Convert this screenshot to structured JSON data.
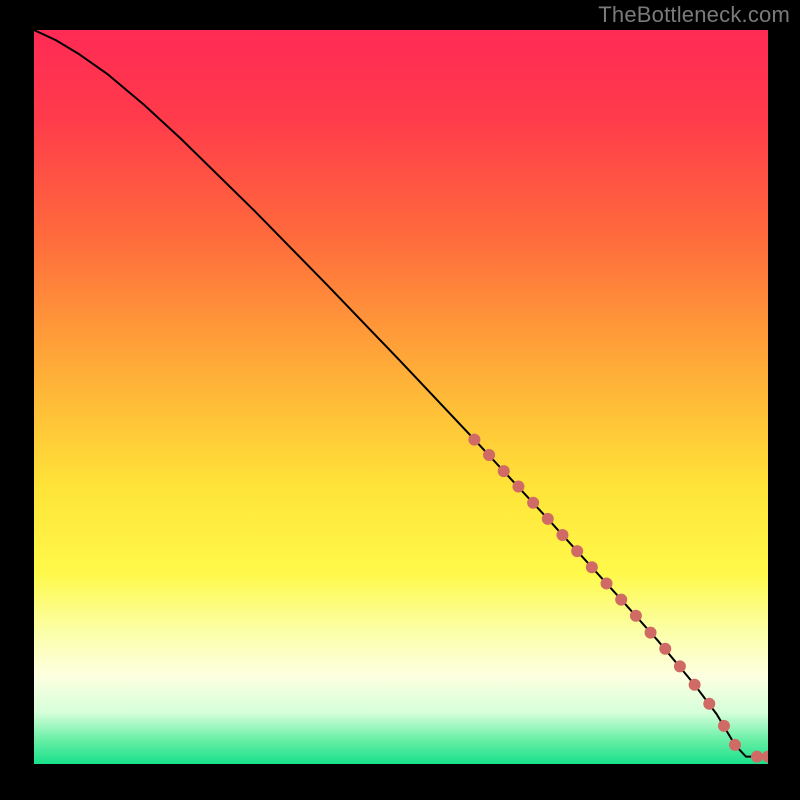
{
  "watermark": "TheBottleneck.com",
  "colors": {
    "frame": "#000000",
    "watermark": "#7a7a7a",
    "gradient_stops": [
      {
        "offset": 0.0,
        "color": "#ff2a55"
      },
      {
        "offset": 0.12,
        "color": "#ff3b4b"
      },
      {
        "offset": 0.28,
        "color": "#ff6a3c"
      },
      {
        "offset": 0.45,
        "color": "#ffa838"
      },
      {
        "offset": 0.62,
        "color": "#ffe338"
      },
      {
        "offset": 0.74,
        "color": "#fff94a"
      },
      {
        "offset": 0.82,
        "color": "#fbffa8"
      },
      {
        "offset": 0.88,
        "color": "#fdffe0"
      },
      {
        "offset": 0.93,
        "color": "#d6ffda"
      },
      {
        "offset": 0.965,
        "color": "#6ef0a8"
      },
      {
        "offset": 1.0,
        "color": "#18e08a"
      }
    ],
    "line": "#000000",
    "marker": "#d06a64"
  },
  "chart_data": {
    "type": "line",
    "title": "",
    "xlabel": "",
    "ylabel": "",
    "xlim": [
      0,
      100
    ],
    "ylim": [
      0,
      100
    ],
    "grid": false,
    "legend": false,
    "series": [
      {
        "name": "curve",
        "x": [
          0,
          3,
          6,
          10,
          15,
          20,
          30,
          40,
          50,
          60,
          70,
          80,
          85,
          90,
          93,
          95.5,
          97,
          100
        ],
        "y": [
          100,
          98.6,
          96.8,
          94.0,
          89.8,
          85.2,
          75.4,
          65.2,
          54.8,
          44.2,
          33.4,
          22.4,
          16.8,
          10.8,
          6.8,
          2.6,
          1.0,
          1.0
        ]
      }
    ],
    "markers": {
      "name": "highlight-points",
      "x": [
        60,
        62,
        64,
        66,
        68,
        70,
        72,
        74,
        76,
        78,
        80,
        82,
        84,
        86,
        88,
        90,
        92,
        94,
        95.5,
        98.5,
        100
      ],
      "y": [
        44.2,
        42.1,
        39.9,
        37.8,
        35.6,
        33.4,
        31.2,
        29.0,
        26.8,
        24.6,
        22.4,
        20.2,
        17.9,
        15.7,
        13.3,
        10.8,
        8.2,
        5.2,
        2.6,
        1.0,
        1.0
      ],
      "r": 6
    }
  }
}
